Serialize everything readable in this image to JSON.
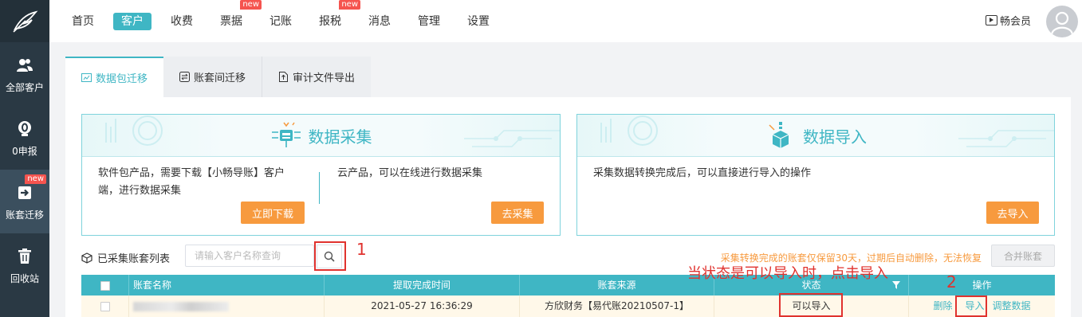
{
  "nav": {
    "items": [
      {
        "label": "首页",
        "active": false,
        "new": false
      },
      {
        "label": "客户",
        "active": true,
        "new": false
      },
      {
        "label": "收费",
        "active": false,
        "new": false
      },
      {
        "label": "票据",
        "active": false,
        "new": true
      },
      {
        "label": "记账",
        "active": false,
        "new": false
      },
      {
        "label": "报税",
        "active": false,
        "new": true
      },
      {
        "label": "消息",
        "active": false,
        "new": false
      },
      {
        "label": "管理",
        "active": false,
        "new": false
      },
      {
        "label": "设置",
        "active": false,
        "new": false
      }
    ],
    "new_badge": "new",
    "vip_label": "畅会员"
  },
  "sidebar": {
    "items": [
      {
        "label": "全部客户",
        "icon": "users-icon"
      },
      {
        "label": "0申报",
        "icon": "zero-declare-icon"
      },
      {
        "label": "账套迁移",
        "icon": "migrate-icon",
        "active": true,
        "new": true
      },
      {
        "label": "回收站",
        "icon": "trash-icon"
      }
    ],
    "new_badge": "new"
  },
  "tabs": [
    {
      "label": "数据包迁移",
      "active": true
    },
    {
      "label": "账套间迁移",
      "active": false
    },
    {
      "label": "审计文件导出",
      "active": false
    }
  ],
  "collect_card": {
    "title": "数据采集",
    "left_text_1": "软件包产品，需要下载【小畅导账】客户",
    "left_text_2": "端，进行数据采集",
    "download_button": "立即下载",
    "right_text": "云产品，可以在线进行数据采集",
    "collect_button": "去采集"
  },
  "import_card": {
    "title": "数据导入",
    "text": "采集数据转换完成后，可以直接进行导入的操作",
    "import_button": "去导入"
  },
  "list": {
    "title": "已采集账套列表",
    "search_placeholder": "请输入客户名称查询",
    "notice": "采集转换完成的账套仅保留30天，过期后自动删除，无法恢复",
    "merge_button": "合并账套"
  },
  "annotations": {
    "step1": "1",
    "step2": "2",
    "note": "当状态是可以导入时，点击导入"
  },
  "table": {
    "headers": {
      "name": "账套名称",
      "time": "提取完成时间",
      "source": "账套来源",
      "status": "状态",
      "ops": "操作"
    },
    "rows": [
      {
        "time": "2021-05-27 16:36:29",
        "source": "方欣财务【易代账20210507-1】",
        "status": "可以导入",
        "op_delete": "删除",
        "op_import": "导入",
        "op_adjust": "调整数据"
      }
    ]
  },
  "colors": {
    "accent": "#3fb6c4",
    "orange": "#f79a3e",
    "sidebar": "#2a3944",
    "annotation_red": "#e0322e"
  }
}
